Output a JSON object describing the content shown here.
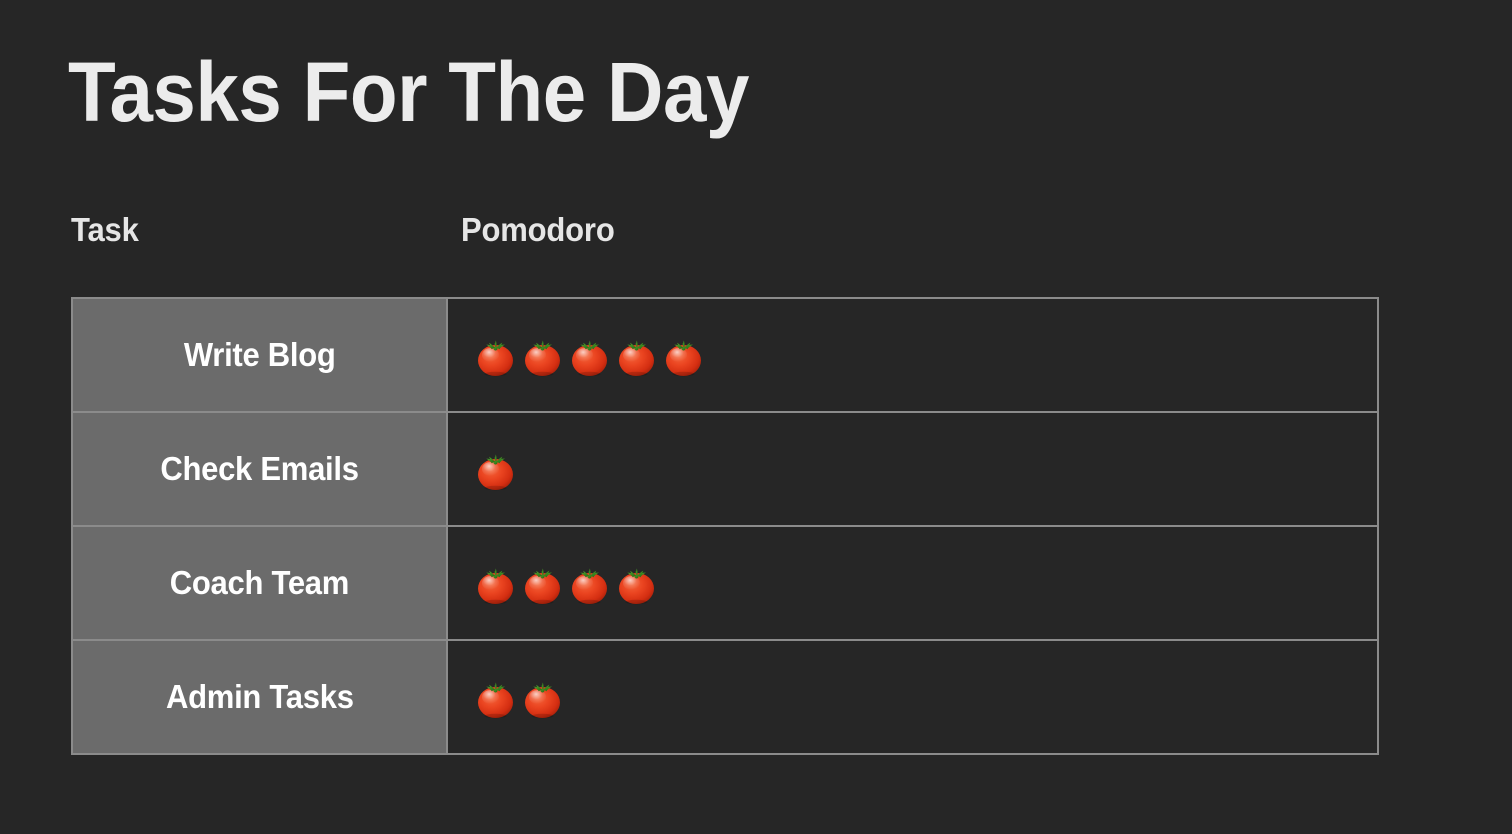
{
  "page": {
    "title": "Tasks For The Day",
    "background_color": "#262626",
    "text_color": "#ececec",
    "accent_color": "#e03b1c"
  },
  "table": {
    "columns": [
      {
        "key": "task",
        "label": "Task"
      },
      {
        "key": "pomodoro",
        "label": "Pomodoro"
      }
    ],
    "header_cell_color": "#6b6b6b",
    "border_color": "#8b8b8b",
    "rows": [
      {
        "task": "Write Blog",
        "pomodoro_count": 5,
        "pomodoro_icon": "tomato-icon"
      },
      {
        "task": "Check Emails",
        "pomodoro_count": 1,
        "pomodoro_icon": "tomato-icon"
      },
      {
        "task": "Coach Team",
        "pomodoro_count": 4,
        "pomodoro_icon": "tomato-icon"
      },
      {
        "task": "Admin Tasks",
        "pomodoro_count": 2,
        "pomodoro_icon": "tomato-icon"
      }
    ]
  }
}
